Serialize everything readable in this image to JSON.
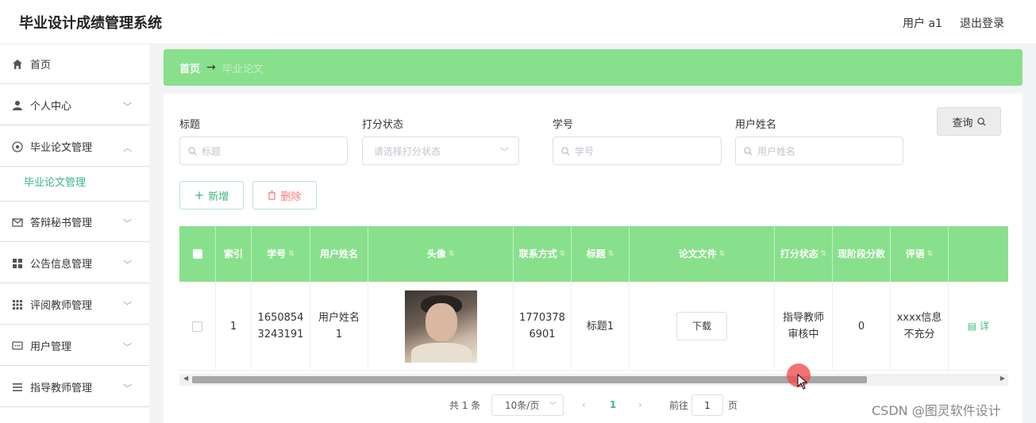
{
  "header": {
    "app_title": "毕业设计成绩管理系统",
    "user_label": "用户 a1",
    "logout_label": "退出登录"
  },
  "sidebar": {
    "items": [
      {
        "label": "首页",
        "icon": "home-icon"
      },
      {
        "label": "个人中心",
        "icon": "user-icon"
      },
      {
        "label": "毕业论文管理",
        "icon": "globe-icon"
      },
      {
        "label": "答辩秘书管理",
        "icon": "mail-icon"
      },
      {
        "label": "公告信息管理",
        "icon": "grid-icon"
      },
      {
        "label": "评阅教师管理",
        "icon": "table-icon"
      },
      {
        "label": "用户管理",
        "icon": "chat-icon"
      },
      {
        "label": "指导教师管理",
        "icon": "list-icon"
      }
    ],
    "active_sub": "毕业论文管理"
  },
  "breadcrumb": {
    "home": "首页",
    "arrow": "→",
    "current": "毕业论文"
  },
  "filters": {
    "title_label": "标题",
    "title_placeholder": "标题",
    "status_label": "打分状态",
    "status_placeholder": "请选择打分状态",
    "student_no_label": "学号",
    "student_no_placeholder": "学号",
    "username_label": "用户姓名",
    "username_placeholder": "用户姓名",
    "query_button": "查询"
  },
  "actions": {
    "add": "新增",
    "delete": "删除"
  },
  "table": {
    "headers": {
      "index": "索引",
      "student_no": "学号",
      "username": "用户姓名",
      "avatar": "头像",
      "contact": "联系方式",
      "title": "标题",
      "file": "论文文件",
      "status": "打分状态",
      "stage_score": "现阶段分数",
      "comment": "评语"
    },
    "rows": [
      {
        "index": "1",
        "student_no": "16508543243191",
        "username": "用户姓名1",
        "contact": "17703786901",
        "title": "标题1",
        "file_button": "下载",
        "status": "指导教师审核中",
        "stage_score": "0",
        "comment": "xxxx信息不充分",
        "detail": "详"
      }
    ]
  },
  "pagination": {
    "total": "共 1 条",
    "page_size": "10条/页",
    "current_page": "1",
    "goto_label": "前往",
    "goto_value": "1",
    "page_suffix": "页"
  },
  "watermark": "CSDN @图灵软件设计",
  "colors": {
    "accent_green": "#88e08c",
    "text_green": "#3cb97a",
    "delete_red": "#f27a7a"
  }
}
